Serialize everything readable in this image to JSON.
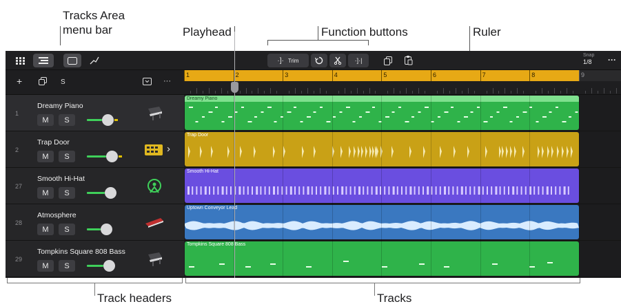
{
  "callouts": {
    "tracks_area_menu_bar": "Tracks Area menu bar",
    "playhead": "Playhead",
    "function_buttons": "Function buttons",
    "ruler": "Ruler",
    "track_headers": "Track headers",
    "tracks": "Tracks"
  },
  "toolbar": {
    "trim_label": "Trim",
    "snap_label": "Snap",
    "snap_value": "1/8",
    "more_label": "···"
  },
  "headers_top": {
    "solo_label": "S",
    "more_label": "···"
  },
  "ruler": {
    "bars": [
      "1",
      "2",
      "3",
      "4",
      "5",
      "6",
      "7",
      "8",
      "9"
    ]
  },
  "tracks": [
    {
      "number": "1",
      "name": "Dreamy Piano",
      "mute": "M",
      "solo": "S",
      "volume": 0.55,
      "instrument_icon": "piano-icon",
      "region": {
        "title": "Dreamy Piano",
        "color": "#2fb34a",
        "header_color": "#7fe08e",
        "kind": "midi"
      }
    },
    {
      "number": "2",
      "name": "Trap Door",
      "mute": "M",
      "solo": "S",
      "volume": 0.7,
      "instrument_icon": "drum-machine-icon",
      "region": {
        "title": "Trap Door",
        "color": "#c9a116",
        "header_color": "#c9a116",
        "kind": "hits"
      }
    },
    {
      "number": "27",
      "name": "Smooth Hi-Hat",
      "mute": "M",
      "solo": "S",
      "volume": 0.65,
      "instrument_icon": "drummer-icon",
      "region": {
        "title": "Smooth Hi-Hat",
        "color": "#6a4ee0",
        "header_color": "#6a4ee0",
        "kind": "hihat"
      }
    },
    {
      "number": "28",
      "name": "Atmosphere",
      "mute": "M",
      "solo": "S",
      "volume": 0.5,
      "instrument_icon": "synth-icon",
      "region": {
        "title": "Uptown Conveyor Lead",
        "color": "#3a78c0",
        "header_color": "#3a78c0",
        "kind": "audio"
      }
    },
    {
      "number": "29",
      "name": "Tompkins Square 808 Bass",
      "mute": "M",
      "solo": "S",
      "volume": 0.6,
      "instrument_icon": "piano-icon",
      "region": {
        "title": "Tompkins Square 808 Bass",
        "color": "#2fb34a",
        "header_color": "#2fb34a",
        "kind": "bass"
      }
    }
  ],
  "colors": {
    "ruler_accent": "#e7a915",
    "background": "#1b1b1d",
    "volume_green": "#3fd05a"
  }
}
